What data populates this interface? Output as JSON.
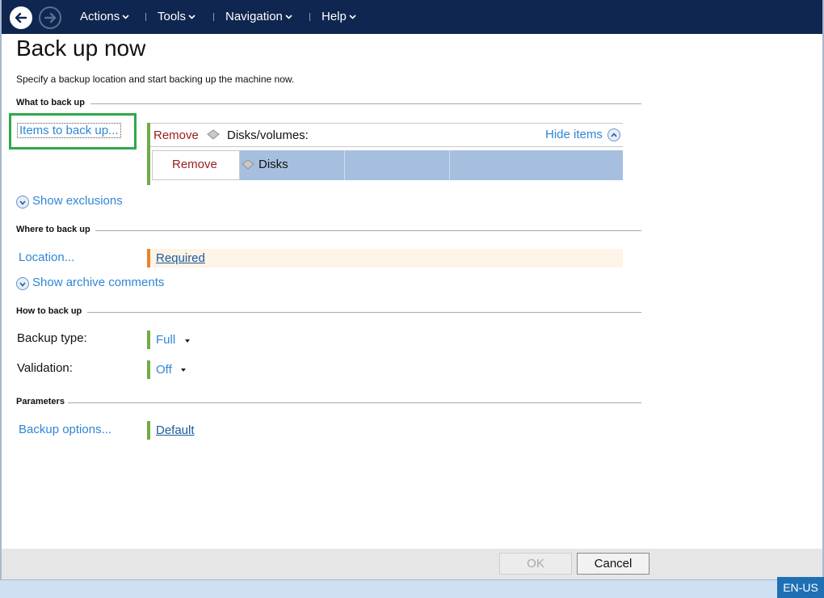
{
  "menu": {
    "actions": "Actions",
    "tools": "Tools",
    "navigation": "Navigation",
    "help": "Help"
  },
  "page": {
    "title": "Back up now",
    "subtitle": "Specify a backup location and start backing up the machine now."
  },
  "what_to_back_up": {
    "heading": "What to back up",
    "items_link": "Items to back up...",
    "remove_label": "Remove",
    "disks_volumes_label": "Disks/volumes:",
    "hide_items": "Hide items",
    "row": {
      "remove": "Remove",
      "item": "Disks"
    },
    "show_exclusions": "Show exclusions"
  },
  "where_to_back_up": {
    "heading": "Where to back up",
    "location_link": "Location...",
    "location_value": "Required",
    "show_comments": "Show archive comments"
  },
  "how_to_back_up": {
    "heading": "How to back up",
    "backup_type_label": "Backup type:",
    "backup_type_value": "Full",
    "validation_label": "Validation:",
    "validation_value": "Off"
  },
  "parameters": {
    "heading": "Parameters",
    "backup_options_link": "Backup options...",
    "backup_options_value": "Default"
  },
  "footer": {
    "ok": "OK",
    "cancel": "Cancel",
    "language": "EN-US"
  },
  "colors": {
    "topbar": "#0f2650",
    "link": "#2f86d4",
    "highlight": "#2fa84a",
    "status_ok": "#6fac45",
    "status_required": "#e8842a"
  }
}
